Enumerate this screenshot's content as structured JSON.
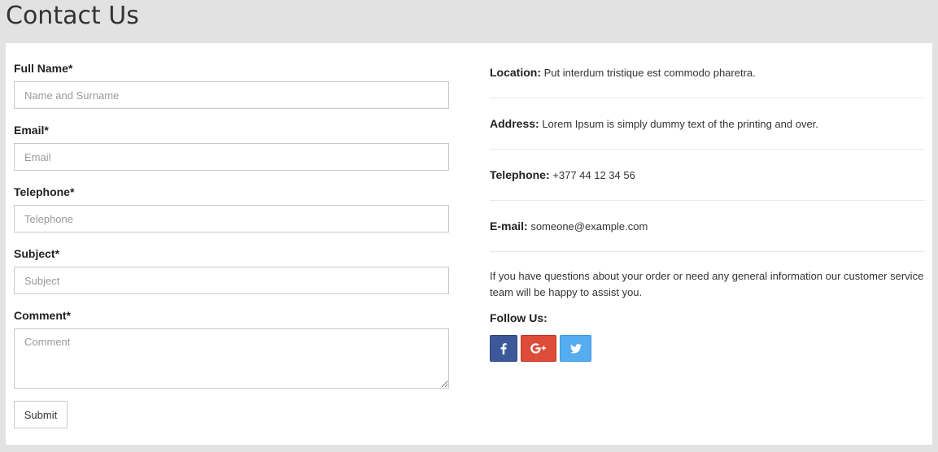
{
  "page": {
    "title": "Contact Us"
  },
  "form": {
    "full_name": {
      "label": "Full Name*",
      "placeholder": "Name and Surname",
      "value": ""
    },
    "email": {
      "label": "Email*",
      "placeholder": "Email",
      "value": ""
    },
    "telephone": {
      "label": "Telephone*",
      "placeholder": "Telephone",
      "value": ""
    },
    "subject": {
      "label": "Subject*",
      "placeholder": "Subject",
      "value": ""
    },
    "comment": {
      "label": "Comment*",
      "placeholder": "Comment",
      "value": ""
    },
    "submit_label": "Submit"
  },
  "info": {
    "location": {
      "label": "Location:",
      "value": "Put interdum tristique est commodo pharetra."
    },
    "address": {
      "label": "Address:",
      "value": "Lorem Ipsum is simply dummy text of the printing and over."
    },
    "telephone": {
      "label": "Telephone:",
      "value": "+377 44 12 34 56"
    },
    "email": {
      "label": "E-mail:",
      "value": "someone@example.com"
    },
    "note": "If you have questions about your order or need any general information our customer service team will be happy to assist you.",
    "follow_title": "Follow Us:"
  },
  "social": [
    {
      "name": "facebook",
      "icon": "facebook-icon",
      "color": "#3b5998"
    },
    {
      "name": "google-plus",
      "icon": "google-plus-icon",
      "color": "#dd4b39"
    },
    {
      "name": "twitter",
      "icon": "twitter-icon",
      "color": "#55acee"
    }
  ]
}
